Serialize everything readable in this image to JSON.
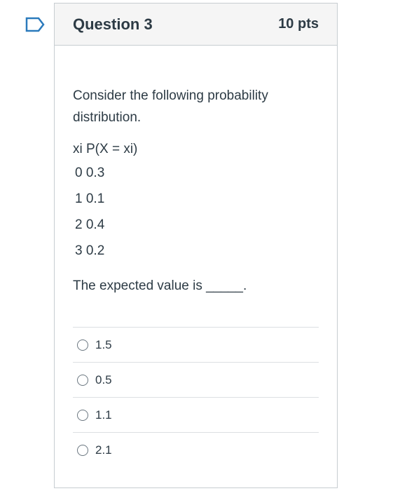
{
  "question": {
    "title": "Question 3",
    "points": "10 pts",
    "prompt": "Consider the following probability distribution.",
    "table_header": "xi P(X = xi)",
    "rows": [
      "0 0.3",
      "1 0.1",
      "2 0.4",
      "3 0.2"
    ],
    "expected_text": "The expected value is _____."
  },
  "answers": [
    "1.5",
    "0.5",
    "1.1",
    "2.1"
  ],
  "colors": {
    "flag": "#2b7abc",
    "border": "#c7cdd1",
    "header_bg": "#f5f5f5",
    "text": "#2d3b45"
  },
  "icons": {
    "flag": "flag-icon",
    "radio": "radio-button-icon"
  }
}
